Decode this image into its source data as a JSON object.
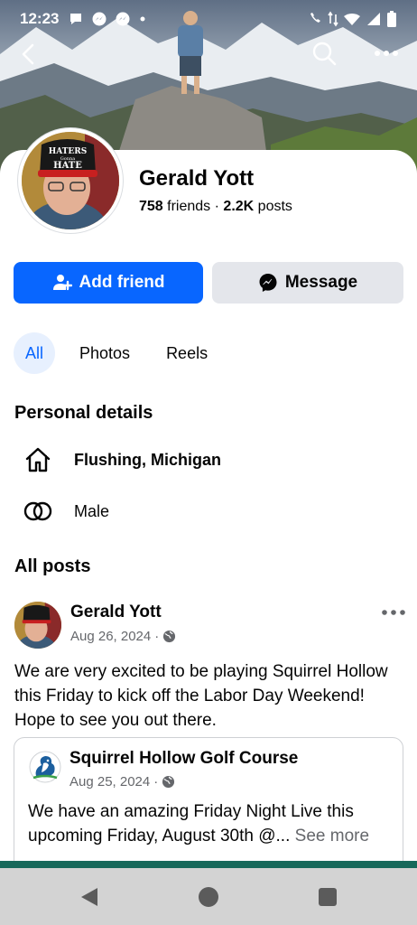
{
  "status_bar": {
    "time": "12:23"
  },
  "profile": {
    "name": "Gerald Yott",
    "friends_count": "758",
    "friends_label": "friends",
    "separator": "·",
    "posts_count": "2.2K",
    "posts_label": "posts",
    "cap_text_line1": "HATERS",
    "cap_text_line2": "Gonna",
    "cap_text_line3": "HATE"
  },
  "actions": {
    "add_friend_label": "Add friend",
    "message_label": "Message"
  },
  "tabs": [
    {
      "label": "All",
      "active": true
    },
    {
      "label": "Photos",
      "active": false
    },
    {
      "label": "Reels",
      "active": false
    }
  ],
  "personal_details": {
    "title": "Personal details",
    "location": "Flushing, Michigan",
    "gender": "Male"
  },
  "posts_section": {
    "title": "All posts"
  },
  "post": {
    "author": "Gerald Yott",
    "date": "Aug 26, 2024",
    "dot": "·",
    "text": "We are very excited to be playing Squirrel Hollow this Friday to kick off the Labor Day Weekend!  Hope to see you out there.",
    "shared": {
      "name": "Squirrel Hollow Golf Course",
      "date": "Aug 25, 2024",
      "text": "We have an amazing Friday Night Live this upcoming Friday, August 30th @...",
      "see_more": "See more"
    }
  },
  "colors": {
    "brand_blue": "#0866ff",
    "secondary_button": "#e4e6eb",
    "active_tab_bg": "#e7f0fe",
    "muted_text": "#65676b"
  },
  "icons": {
    "back": "arrow-left-icon",
    "search": "search-icon",
    "more": "more-horizontal-icon",
    "add_friend": "person-add-icon",
    "message": "messenger-icon",
    "location": "home-icon",
    "gender": "gender-rings-icon",
    "privacy": "globe-icon"
  }
}
